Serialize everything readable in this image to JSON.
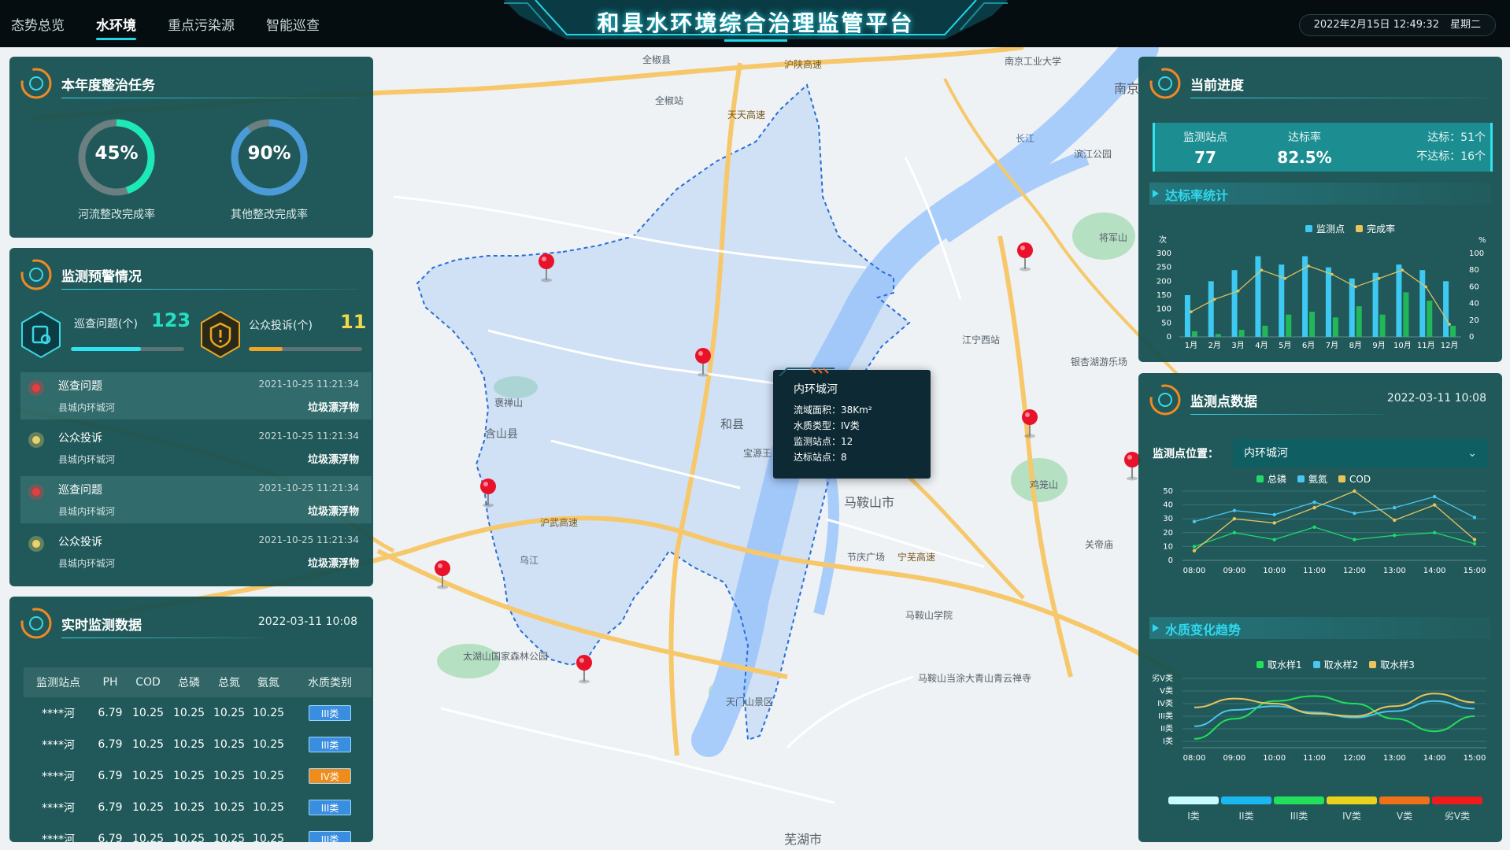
{
  "header": {
    "title": "和县水环境综合治理监管平台",
    "nav": [
      "态势总览",
      "水环境",
      "重点污染源",
      "智能巡查"
    ],
    "active_nav": 1,
    "date": "2022年2月15日 12:49:32",
    "weekday": "星期二"
  },
  "annual_task": {
    "title": "本年度整治任务",
    "items": [
      {
        "value": "45%",
        "fraction": 0.45,
        "label": "河流整改完成率",
        "color": "#1de9b6"
      },
      {
        "value": "90%",
        "fraction": 0.9,
        "label": "其他整改完成率",
        "color": "#4a9bd8"
      }
    ]
  },
  "warning": {
    "title": "监测预警情况",
    "patrol_label": "巡查问题(个)",
    "patrol_count": "123",
    "patrol_fraction": 0.62,
    "complaint_label": "公众投诉(个)",
    "complaint_count": "11",
    "complaint_fraction": 0.3,
    "alerts": [
      {
        "type": "巡查问题",
        "time": "2021-10-25 11:21:34",
        "location": "县城内环城河",
        "tag": "垃圾漂浮物",
        "color": "#f03a3a",
        "shade": true
      },
      {
        "type": "公众投诉",
        "time": "2021-10-25 11:21:34",
        "location": "县城内环城河",
        "tag": "垃圾漂浮物",
        "color": "#e8d36a",
        "shade": false
      },
      {
        "type": "巡查问题",
        "time": "2021-10-25 11:21:34",
        "location": "县城内环城河",
        "tag": "垃圾漂浮物",
        "color": "#f03a3a",
        "shade": true
      },
      {
        "type": "公众投诉",
        "time": "2021-10-25 11:21:34",
        "location": "县城内环城河",
        "tag": "垃圾漂浮物",
        "color": "#e8d36a",
        "shade": false
      }
    ]
  },
  "realtime": {
    "title": "实时监测数据",
    "date": "2022-03-11 10:08",
    "columns": [
      "监测站点",
      "PH",
      "COD",
      "总磷",
      "总氮",
      "氨氮",
      "水质类别"
    ],
    "rows": [
      [
        "****河",
        "6.79",
        "10.25",
        "10.25",
        "10.25",
        "10.25",
        "III类"
      ],
      [
        "****河",
        "6.79",
        "10.25",
        "10.25",
        "10.25",
        "10.25",
        "III类"
      ],
      [
        "****河",
        "6.79",
        "10.25",
        "10.25",
        "10.25",
        "10.25",
        "IV类"
      ],
      [
        "****河",
        "6.79",
        "10.25",
        "10.25",
        "10.25",
        "10.25",
        "III类"
      ],
      [
        "****河",
        "6.79",
        "10.25",
        "10.25",
        "10.25",
        "10.25",
        "III类"
      ]
    ],
    "class_colors": {
      "III类": "#3a8ee0",
      "IV类": "#f08c1a"
    }
  },
  "progress": {
    "title": "当前进度",
    "stations_label": "监测站点",
    "stations": "77",
    "rate_label": "达标率",
    "rate": "82.5%",
    "ok_text": "达标：51个",
    "not_ok_text": "不达标：16个",
    "sub_title": "达标率统计",
    "legend": [
      "监测点",
      "完成率"
    ]
  },
  "monitor": {
    "title": "监测点数据",
    "date": "2022-03-11 10:08",
    "location_label": "监测点位置：",
    "location_value": "内环城河",
    "legend": [
      "总磷",
      "氨氮",
      "COD"
    ],
    "trend_title": "水质变化趋势",
    "trend_legend": [
      "取水样1",
      "取水样2",
      "取水样3"
    ],
    "scale": [
      {
        "label": "I类",
        "color": "#c8fbff"
      },
      {
        "label": "II类",
        "color": "#1ab8f0"
      },
      {
        "label": "III类",
        "color": "#22e05a"
      },
      {
        "label": "IV类",
        "color": "#e8d21c"
      },
      {
        "label": "V类",
        "color": "#f07018"
      },
      {
        "label": "劣V类",
        "color": "#f01c1c"
      }
    ]
  },
  "popup": {
    "title": "内环城河",
    "rows": [
      "流域面积：38Km²",
      "水质类型：IV类",
      "监测站点：12",
      "达标站点：8"
    ]
  },
  "map_labels": [
    "全椒县",
    "南京工业大学",
    "南京",
    "全椒站",
    "滨江公园",
    "将军山",
    "江宁西站",
    "银杏湖游乐场",
    "和县",
    "马鞍山市",
    "含山县",
    "褒禅山",
    "鸡笼山",
    "关帝庙",
    "节庆广场",
    "马鞍山学院",
    "马鞍山当涂大青山青云禅寺",
    "太湖山国家森林公园",
    "天门山景区",
    "芜湖市",
    "宝源王",
    "乌江",
    "沪陕高速",
    "天天高速",
    "沪武高速",
    "宁芜高速",
    "长江"
  ],
  "chart_data": [
    {
      "type": "bar",
      "title": "达标率统计",
      "categories": [
        "1月",
        "2月",
        "3月",
        "4月",
        "5月",
        "6月",
        "7月",
        "8月",
        "9月",
        "10月",
        "11月",
        "12月"
      ],
      "series": [
        {
          "name": "监测点",
          "axis": "left",
          "values": [
            150,
            200,
            240,
            290,
            260,
            290,
            250,
            210,
            230,
            260,
            240,
            200
          ]
        },
        {
          "name": "完成率",
          "axis": "right",
          "values": [
            30,
            45,
            55,
            80,
            70,
            85,
            75,
            60,
            70,
            80,
            60,
            15
          ]
        }
      ],
      "extra_bars": [
        20,
        10,
        25,
        40,
        80,
        90,
        70,
        110,
        80,
        160,
        130,
        40
      ],
      "ylabel": "次",
      "y2label": "%",
      "ylim": [
        0,
        300
      ],
      "y2lim": [
        0,
        100
      ],
      "yticks": [
        0,
        50,
        100,
        150,
        200,
        250,
        300
      ],
      "y2ticks": [
        0,
        20,
        40,
        60,
        80,
        100
      ],
      "legend_placement": "top-right"
    },
    {
      "type": "line",
      "title": "监测点数据",
      "categories": [
        "08:00",
        "09:00",
        "10:00",
        "11:00",
        "12:00",
        "13:00",
        "14:00",
        "15:00"
      ],
      "series": [
        {
          "name": "总磷",
          "color": "#22d86a",
          "values": [
            10,
            20,
            15,
            24,
            15,
            18,
            20,
            12
          ]
        },
        {
          "name": "氨氮",
          "color": "#4ac6f0",
          "values": [
            28,
            36,
            33,
            42,
            34,
            38,
            46,
            31
          ]
        },
        {
          "name": "COD",
          "color": "#e8c45c",
          "values": [
            7,
            30,
            27,
            38,
            50,
            29,
            40,
            15
          ]
        }
      ],
      "ylim": [
        0,
        50
      ],
      "yticks": [
        0,
        10,
        20,
        30,
        40,
        50
      ],
      "legend_placement": "top"
    },
    {
      "type": "line",
      "title": "水质变化趋势",
      "categories": [
        "08:00",
        "09:00",
        "10:00",
        "11:00",
        "12:00",
        "13:00",
        "14:00",
        "15:00"
      ],
      "yticks_labels": [
        "I类",
        "II类",
        "III类",
        "IV类",
        "V类",
        "劣V类"
      ],
      "series": [
        {
          "name": "取水样1",
          "color": "#22e05a",
          "values": [
            1.2,
            2.8,
            4.2,
            4.6,
            4.0,
            2.8,
            1.8,
            3.0
          ]
        },
        {
          "name": "取水样2",
          "color": "#4ac6f0",
          "values": [
            2.2,
            3.5,
            3.8,
            3.3,
            2.9,
            3.4,
            4.2,
            3.6
          ]
        },
        {
          "name": "取水样3",
          "color": "#e8c45c",
          "values": [
            3.7,
            4.4,
            4.0,
            3.2,
            3.0,
            3.8,
            4.8,
            4.1
          ]
        }
      ],
      "ylim": [
        0.5,
        6
      ],
      "legend_placement": "top"
    }
  ]
}
